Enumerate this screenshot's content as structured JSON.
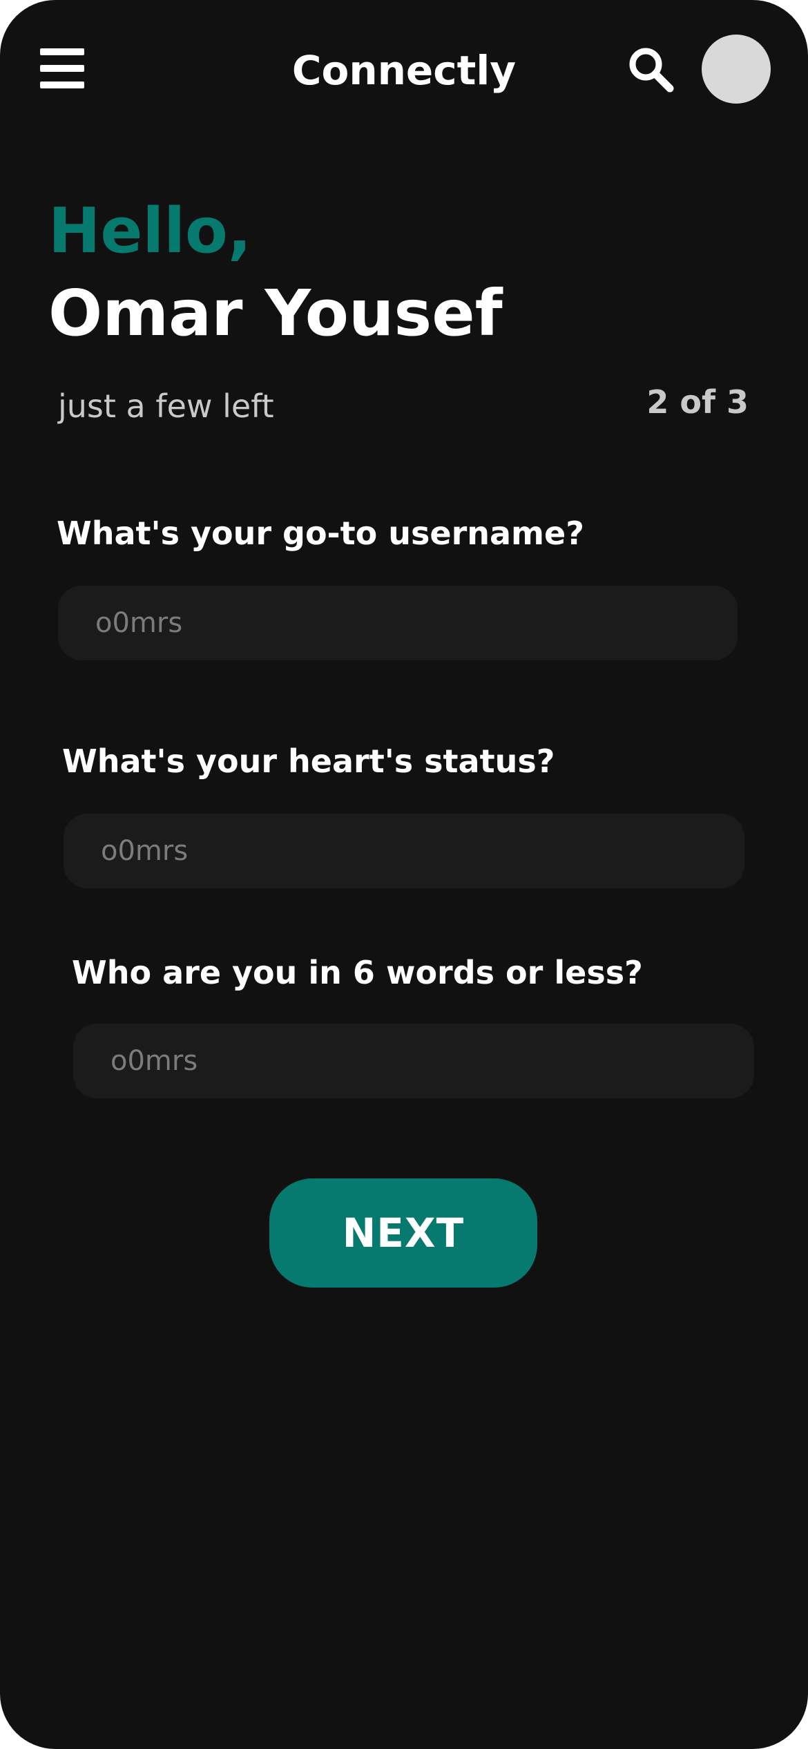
{
  "header": {
    "menu_icon": "hamburger-menu-icon",
    "app_title": "Connectly",
    "search_icon": "search-icon",
    "avatar_color": "#d9d9d9"
  },
  "greeting": {
    "hello": "Hello,",
    "name": "Omar Yousef",
    "subtitle": "just a few left",
    "step": "2 of 3"
  },
  "form": {
    "questions": [
      {
        "label": "What's your go-to username?",
        "placeholder": "o0mrs"
      },
      {
        "label": "What's your heart's status?",
        "placeholder": "o0mrs"
      },
      {
        "label": "Who are you in 6 words or less?",
        "placeholder": "o0mrs"
      }
    ],
    "next_label": "NEXT"
  },
  "colors": {
    "background": "#111111",
    "accent": "#077a6f",
    "field_background": "#1b1b1b",
    "muted_text": "#c9c9c9"
  }
}
